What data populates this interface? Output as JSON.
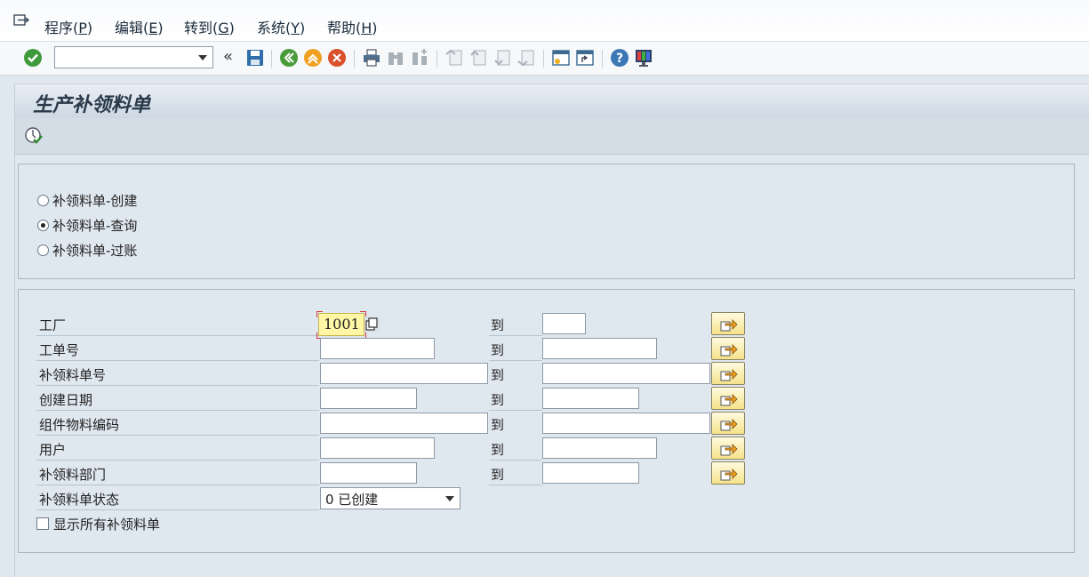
{
  "menu": {
    "items": [
      {
        "text": "程序(",
        "key": "P",
        "end": ")"
      },
      {
        "text": "编辑(",
        "key": "E",
        "end": ")"
      },
      {
        "text": "转到(",
        "key": "G",
        "end": ")"
      },
      {
        "text": "系统(",
        "key": "Y",
        "end": ")"
      },
      {
        "text": "帮助(",
        "key": "H",
        "end": ")"
      }
    ]
  },
  "toolbar": {
    "command_value": "",
    "expand_label": "«"
  },
  "title": "生产补领料单",
  "options": [
    {
      "label": "补领料单-创建",
      "selected": false
    },
    {
      "label": "补领料单-查询",
      "selected": true
    },
    {
      "label": "补领料单-过账",
      "selected": false
    }
  ],
  "fields": {
    "plant": {
      "label": "工厂",
      "low": "1001",
      "high": ""
    },
    "work_order": {
      "label": "工单号",
      "low": "",
      "high": ""
    },
    "requisition_no": {
      "label": "补领料单号",
      "low": "",
      "high": ""
    },
    "created_date": {
      "label": "创建日期",
      "low": "",
      "high": ""
    },
    "component_material": {
      "label": "组件物料编码",
      "low": "",
      "high": ""
    },
    "user": {
      "label": "用户",
      "low": "",
      "high": ""
    },
    "department": {
      "label": "补领料部门",
      "low": "",
      "high": ""
    },
    "status": {
      "label": "补领料单状态",
      "value": "0 已创建"
    }
  },
  "to_label": "到",
  "show_all_label": "显示所有补领料单"
}
